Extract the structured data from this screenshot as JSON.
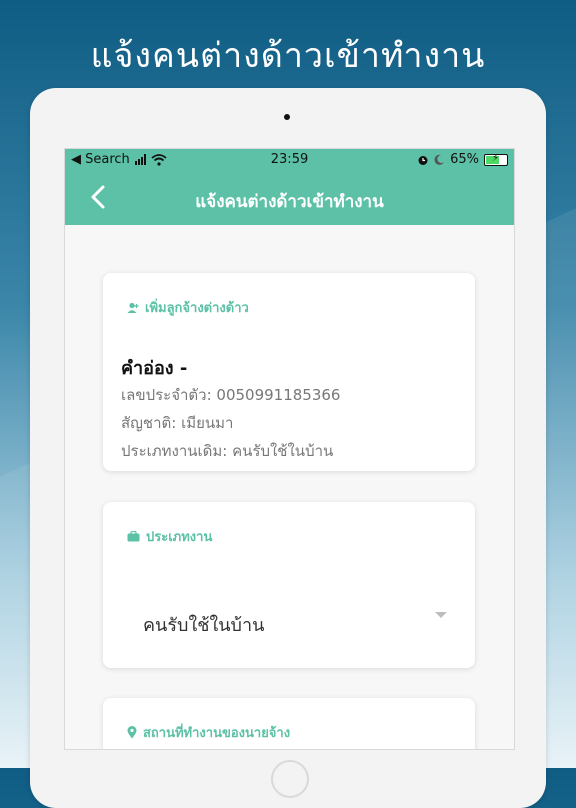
{
  "promo": {
    "headline": "แจ้งคนต่างด้าวเข้าทำงาน"
  },
  "status_bar": {
    "back_app": "◀ Search",
    "time": "23:59",
    "battery_percent": "65%",
    "battery_level": 0.65
  },
  "nav": {
    "title": "แจ้งคนต่างด้าวเข้าทำงาน"
  },
  "employee_card": {
    "section_title": "เพิ่มลูกจ้างต่างด้าว",
    "name": "คำอ่อง -",
    "id_line": "เลขประจำตัว: 0050991185366",
    "nationality_line": "สัญชาติ: เมียนมา",
    "previous_job_line": "ประเภทงานเดิม: คนรับใช้ในบ้าน"
  },
  "job_type_card": {
    "section_title": "ประเภทงาน",
    "selected_value": "คนรับใช้ในบ้าน"
  },
  "workplace_card": {
    "section_title": "สถานที่ทำงานของนายจ้าง"
  },
  "colors": {
    "accent": "#5cc1a6",
    "background_top": "#0f5c84"
  },
  "icons": {
    "back": "chevron-left-icon",
    "employee": "person-add-icon",
    "job": "briefcase-icon",
    "location": "map-pin-icon"
  }
}
